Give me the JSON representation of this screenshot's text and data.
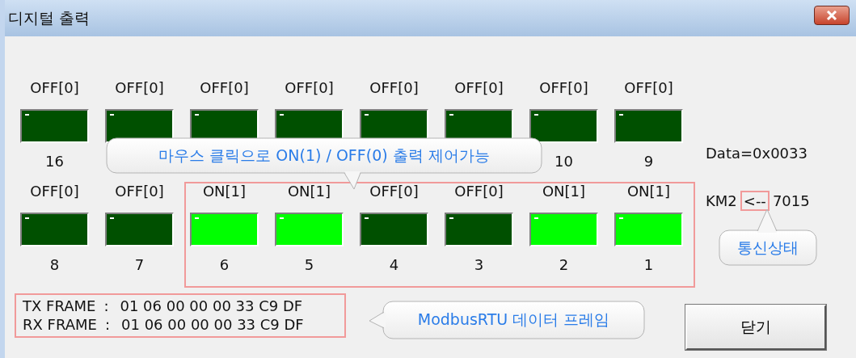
{
  "window": {
    "title": "디지털 출력"
  },
  "rows": [
    {
      "items": [
        {
          "state": "OFF[0]",
          "on": false,
          "number": "16"
        },
        {
          "state": "OFF[0]",
          "on": false
        },
        {
          "state": "OFF[0]",
          "on": false
        },
        {
          "state": "OFF[0]",
          "on": false
        },
        {
          "state": "OFF[0]",
          "on": false
        },
        {
          "state": "OFF[0]",
          "on": false
        },
        {
          "state": "OFF[0]",
          "on": false,
          "number": "10"
        },
        {
          "state": "OFF[0]",
          "on": false,
          "number": "9"
        }
      ]
    },
    {
      "items": [
        {
          "state": "OFF[0]",
          "on": false,
          "number": "8"
        },
        {
          "state": "OFF[0]",
          "on": false,
          "number": "7"
        },
        {
          "state": "ON[1]",
          "on": true,
          "number": "6"
        },
        {
          "state": "ON[1]",
          "on": true,
          "number": "5"
        },
        {
          "state": "OFF[0]",
          "on": false,
          "number": "4"
        },
        {
          "state": "OFF[0]",
          "on": false,
          "number": "3"
        },
        {
          "state": "ON[1]",
          "on": true,
          "number": "2"
        },
        {
          "state": "ON[1]",
          "on": true,
          "number": "1"
        }
      ]
    }
  ],
  "data_value": "Data=0x0033",
  "status": {
    "device": "KM2",
    "indicator": "<--",
    "value": "7015"
  },
  "frames": [
    {
      "label": "TX FRAME",
      "separator": ":",
      "bytes": "01 06 00 00 00 33 C9 DF"
    },
    {
      "label": "RX FRAME",
      "separator": ":",
      "bytes": "01 06 00 00 00 33 C9 DF"
    }
  ],
  "close_button": "닫기",
  "callouts": [
    {
      "kind": "down",
      "text": "마우스 클릭으로 ON(1) / OFF(0) 출력 제어가능"
    },
    {
      "kind": "up",
      "text": "통신상태"
    },
    {
      "kind": "left",
      "text": "ModbusRTU 데이터 프레임"
    }
  ]
}
